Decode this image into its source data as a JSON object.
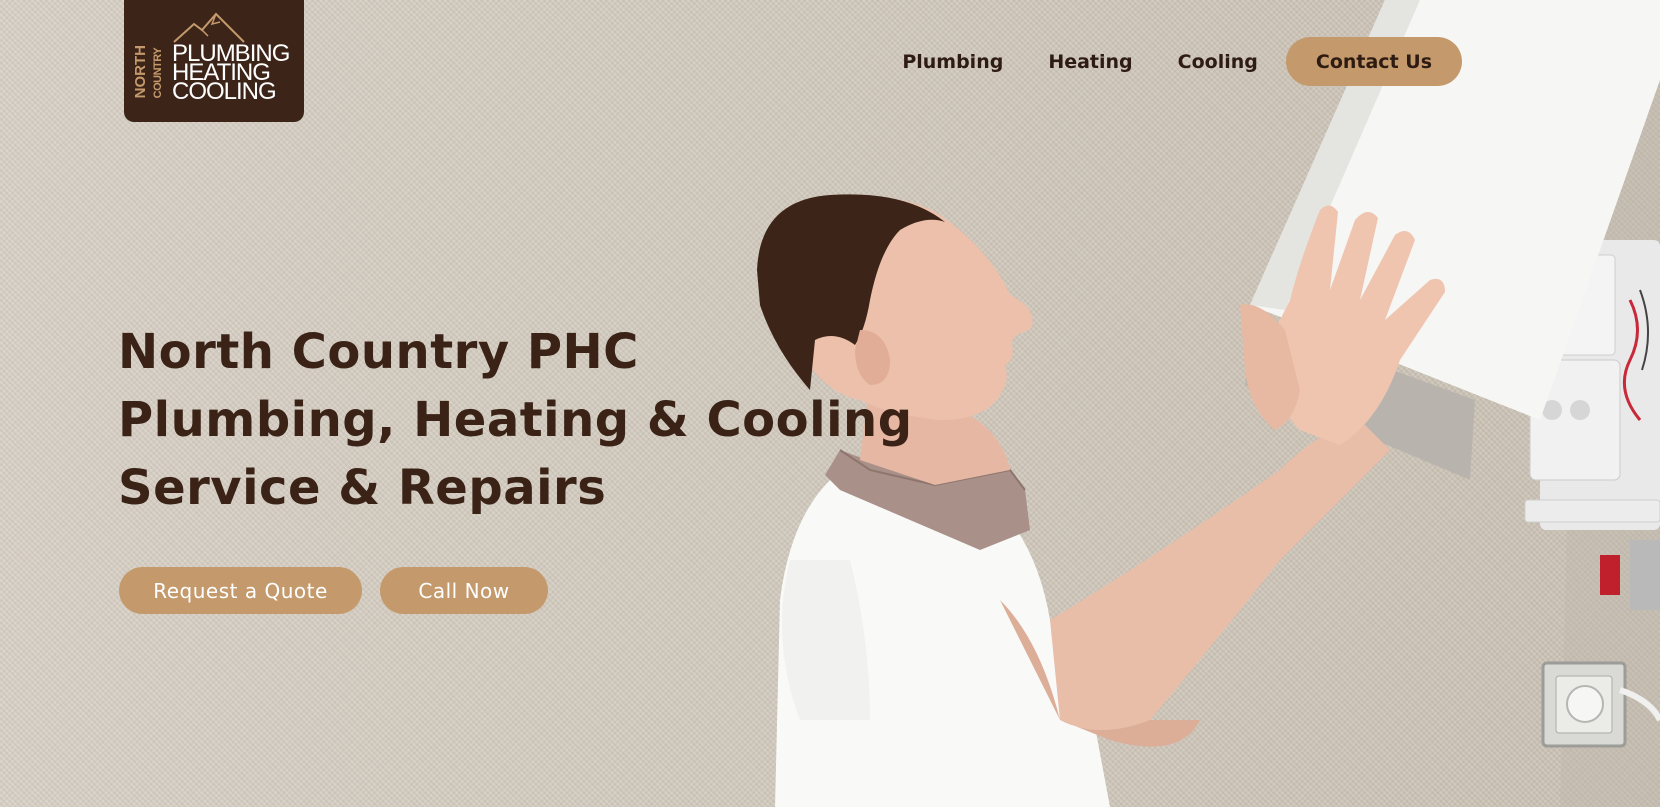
{
  "brand": {
    "logo_side_text": [
      "NORTH",
      "COUNTRY"
    ],
    "logo_lines": [
      "PLUMBING",
      "HEATING",
      "COOLING"
    ],
    "logo_icon": "mountain-icon"
  },
  "nav": {
    "items": [
      {
        "label": "Plumbing"
      },
      {
        "label": "Heating"
      },
      {
        "label": "Cooling"
      }
    ],
    "contact_label": "Contact Us"
  },
  "hero": {
    "lines": [
      "North Country PHC",
      "Plumbing, Heating & Cooling",
      "Service & Repairs"
    ],
    "primary_cta": "Request a Quote",
    "secondary_cta": "Call Now"
  },
  "colors": {
    "brand_dark": "#3d2418",
    "accent": "#c49a6c",
    "text_dark": "#3a2216",
    "background": "#d4ccc0"
  }
}
